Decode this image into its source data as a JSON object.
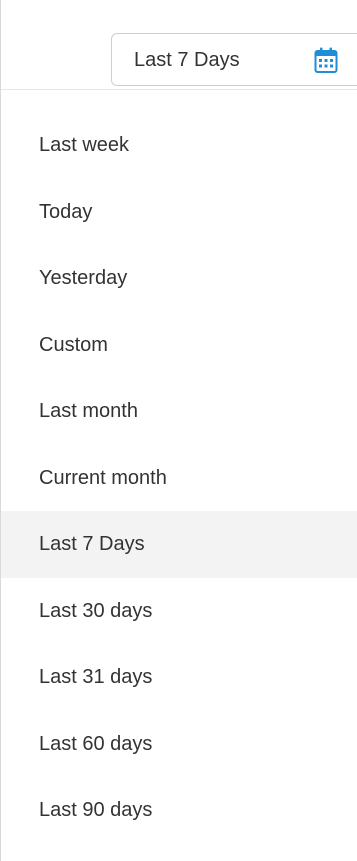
{
  "date_range": {
    "selected_label": "Last 7 Days",
    "icon": "calendar-icon",
    "accent_color": "#1f8ed8"
  },
  "options": [
    "Last week",
    "Today",
    "Yesterday",
    "Custom",
    "Last month",
    "Current month",
    "Last 7 Days",
    "Last 30 days",
    "Last 31 days",
    "Last 60 days",
    "Last 90 days"
  ],
  "selected_option": "Last 7 Days",
  "highlight_color": "#f3f3f3"
}
